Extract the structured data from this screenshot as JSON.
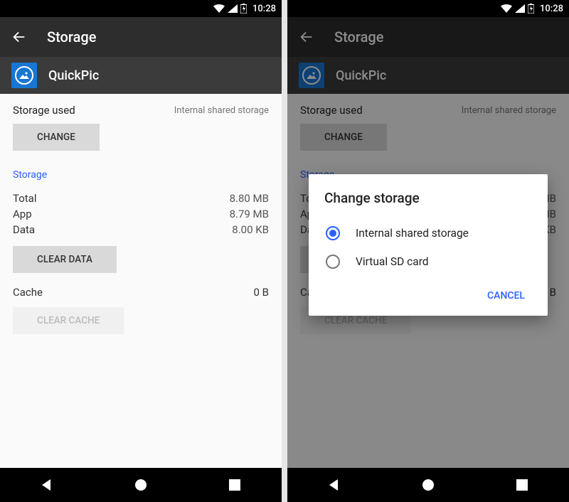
{
  "status": {
    "time": "10:28"
  },
  "toolbar": {
    "title": "Storage"
  },
  "app": {
    "name": "QuickPic"
  },
  "storage_used": {
    "label": "Storage used",
    "note": "Internal shared storage",
    "change_label": "CHANGE"
  },
  "section": {
    "title": "Storage",
    "rows": [
      {
        "label": "Total",
        "value": "8.80 MB"
      },
      {
        "label": "App",
        "value": "8.79 MB"
      },
      {
        "label": "Data",
        "value": "8.00 KB"
      }
    ],
    "clear_data_label": "CLEAR DATA"
  },
  "cache": {
    "label": "Cache",
    "value": "0 B",
    "clear_cache_label": "CLEAR CACHE"
  },
  "dialog": {
    "title": "Change storage",
    "options": [
      "Internal shared storage",
      "Virtual SD card"
    ],
    "selected_index": 0,
    "cancel_label": "CANCEL"
  }
}
